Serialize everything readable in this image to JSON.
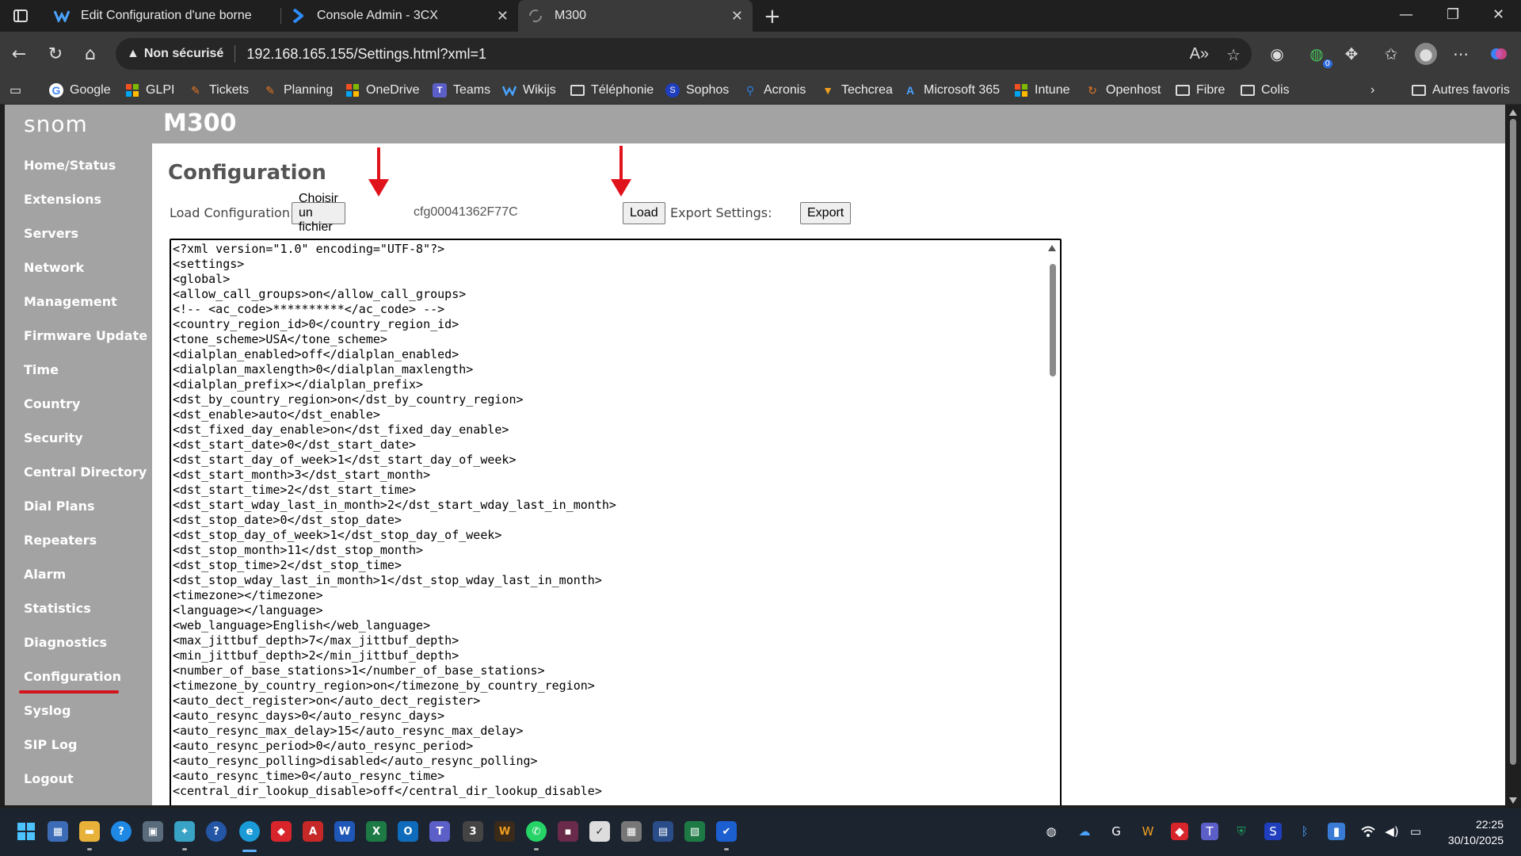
{
  "browser": {
    "tabs": [
      {
        "title": "Edit Configuration d'une borne SNOM",
        "active": false
      },
      {
        "title": "Console Admin - 3CX",
        "active": false
      },
      {
        "title": "M300",
        "active": true
      }
    ],
    "security_label": "Non sécurisé",
    "url": "192.168.165.155/Settings.html?xml=1",
    "bookmarks": [
      {
        "label": "Google",
        "icon": "google-icon"
      },
      {
        "label": "GLPI",
        "icon": "windows-grid-icon"
      },
      {
        "label": "Tickets",
        "icon": "bookmark-icon"
      },
      {
        "label": "Planning",
        "icon": "bookmark-icon"
      },
      {
        "label": "OneDrive",
        "icon": "windows-grid-icon"
      },
      {
        "label": "Teams",
        "icon": "teams-icon"
      },
      {
        "label": "Wikijs",
        "icon": "wikijs-icon"
      },
      {
        "label": "Téléphonie",
        "icon": "folder-icon"
      },
      {
        "label": "Sophos",
        "icon": "sophos-icon"
      },
      {
        "label": "Acronis",
        "icon": "acronis-icon"
      },
      {
        "label": "Techcrea",
        "icon": "techcrea-icon"
      },
      {
        "label": "Microsoft 365",
        "icon": "m365-icon"
      },
      {
        "label": "Intune",
        "icon": "windows-grid-icon"
      },
      {
        "label": "Openhost",
        "icon": "openhost-icon"
      },
      {
        "label": "Fibre",
        "icon": "folder-icon"
      },
      {
        "label": "Colis",
        "icon": "folder-icon"
      }
    ],
    "other_bookmarks": "Autres favoris",
    "ext_badge": "0"
  },
  "snom": {
    "brand": "snom",
    "model": "M300",
    "nav": [
      "Home/Status",
      "Extensions",
      "Servers",
      "Network",
      "Management",
      "Firmware Update",
      "Time",
      "Country",
      "Security",
      "Central Directory",
      "Dial Plans",
      "Repeaters",
      "Alarm",
      "Statistics",
      "Diagnostics",
      "Configuration",
      "Syslog",
      "SIP Log",
      "Logout"
    ],
    "active_nav": "Configuration",
    "page_title": "Configuration",
    "load_label": "Load Configuration:",
    "choose_file": "Choisir un fichier",
    "file_name": "cfg00041362F77C",
    "load_button": "Load",
    "export_label": "Export Settings:",
    "export_button": "Export",
    "xml_lines": [
      "<?xml version=\"1.0\" encoding=\"UTF-8\"?>",
      "<settings>",
      "<global>",
      "<allow_call_groups>on</allow_call_groups>",
      "<!-- <ac_code>**********</ac_code> -->",
      "<country_region_id>0</country_region_id>",
      "<tone_scheme>USA</tone_scheme>",
      "<dialplan_enabled>off</dialplan_enabled>",
      "<dialplan_maxlength>0</dialplan_maxlength>",
      "<dialplan_prefix></dialplan_prefix>",
      "<dst_by_country_region>on</dst_by_country_region>",
      "<dst_enable>auto</dst_enable>",
      "<dst_fixed_day_enable>on</dst_fixed_day_enable>",
      "<dst_start_date>0</dst_start_date>",
      "<dst_start_day_of_week>1</dst_start_day_of_week>",
      "<dst_start_month>3</dst_start_month>",
      "<dst_start_time>2</dst_start_time>",
      "<dst_start_wday_last_in_month>2</dst_start_wday_last_in_month>",
      "<dst_stop_date>0</dst_stop_date>",
      "<dst_stop_day_of_week>1</dst_stop_day_of_week>",
      "<dst_stop_month>11</dst_stop_month>",
      "<dst_stop_time>2</dst_stop_time>",
      "<dst_stop_wday_last_in_month>1</dst_stop_wday_last_in_month>",
      "<timezone></timezone>",
      "<language></language>",
      "<web_language>English</web_language>",
      "<max_jittbuf_depth>7</max_jittbuf_depth>",
      "<min_jittbuf_depth>2</min_jittbuf_depth>",
      "<number_of_base_stations>1</number_of_base_stations>",
      "<timezone_by_country_region>on</timezone_by_country_region>",
      "<auto_dect_register>on</auto_dect_register>",
      "<auto_resync_days>0</auto_resync_days>",
      "<auto_resync_max_delay>15</auto_resync_max_delay>",
      "<auto_resync_period>0</auto_resync_period>",
      "<auto_resync_polling>disabled</auto_resync_polling>",
      "<auto_resync_time>0</auto_resync_time>",
      "<central_dir_lookup_disable>off</central_dir_lookup_disable>"
    ]
  },
  "taskbar": {
    "time": "22:25",
    "date": "30/10/2025"
  },
  "colors": {
    "snom_gray": "#a3a3a3",
    "annotation_red": "#e0121b",
    "taskbar": "#1c2430"
  }
}
